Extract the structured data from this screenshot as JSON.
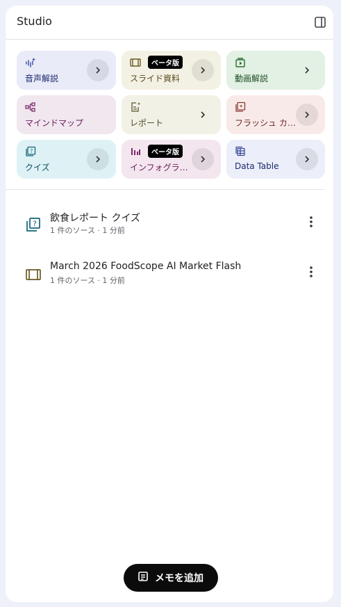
{
  "studio": {
    "title": "Studio"
  },
  "tools": [
    {
      "label": "音声解説",
      "icon": "audio-sparkle-icon",
      "beta": ""
    },
    {
      "label": "スライド資料",
      "icon": "slides-icon",
      "beta": "ベータ版"
    },
    {
      "label": "動画解説",
      "icon": "video-icon",
      "beta": ""
    },
    {
      "label": "マインドマップ",
      "icon": "mind-map-icon",
      "beta": ""
    },
    {
      "label": "レポート",
      "icon": "report-icon",
      "beta": ""
    },
    {
      "label": "フラッシュ カ…",
      "icon": "flashcard-icon",
      "beta": ""
    },
    {
      "label": "クイズ",
      "icon": "quiz-icon",
      "beta": ""
    },
    {
      "label": "インフォグラ…",
      "icon": "infographic-icon",
      "beta": "ベータ版"
    },
    {
      "label": "Data Table",
      "icon": "data-table-icon",
      "beta": ""
    }
  ],
  "notes": [
    {
      "title": "飲食レポート クイズ",
      "meta": "1 件のソース · 1 分前",
      "icon": "quiz-icon"
    },
    {
      "title": "March 2026 FoodScope AI Market Flash",
      "meta": "1 件のソース · 1 分前",
      "icon": "slides-icon"
    }
  ],
  "add_note": {
    "label": "メモを追加"
  },
  "colors": {
    "background": "#eef0fa",
    "button": "#0b0b0b"
  }
}
